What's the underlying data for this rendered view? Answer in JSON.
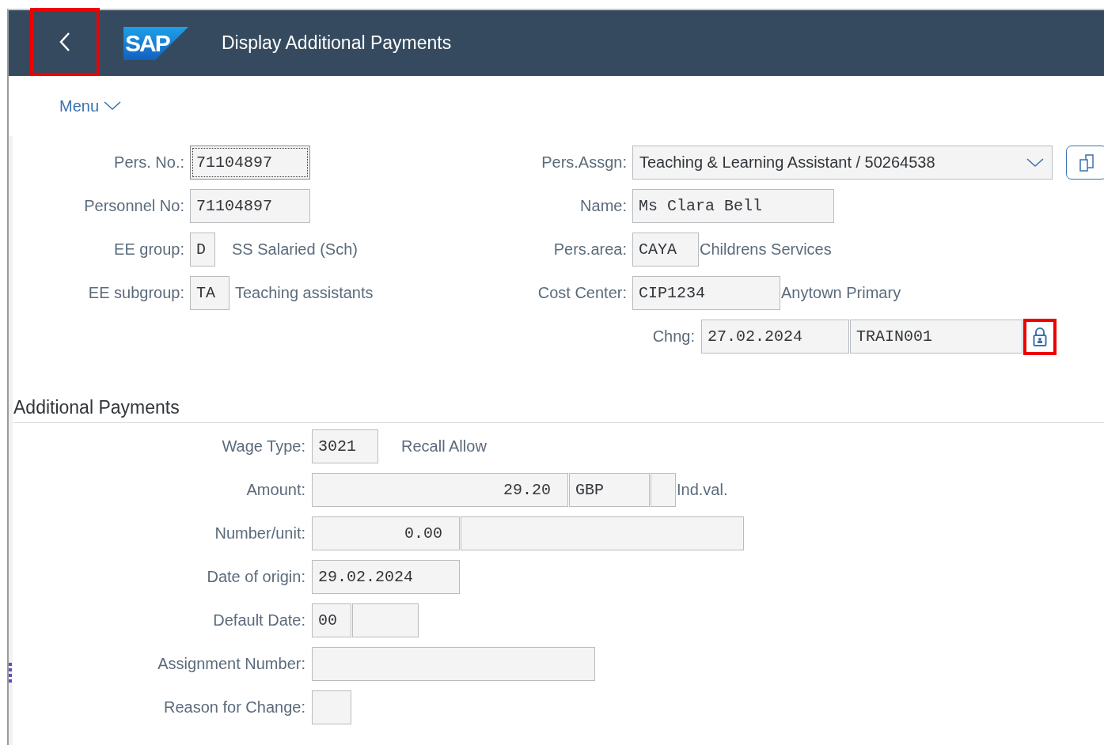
{
  "header": {
    "back_button": {
      "highlighted": true
    },
    "logo": "SAP",
    "title": "Display Additional Payments"
  },
  "menu": "Menu",
  "left_rows": [
    {
      "label": "Pers. No.:",
      "fields": [
        {
          "value": "71104897",
          "focused": true
        }
      ]
    },
    {
      "label": "Personnel No:",
      "fields": [
        {
          "value": "71104897",
          "focused": false
        }
      ]
    },
    {
      "label": "EE group:",
      "fields": [
        {
          "value": "D",
          "focused": false
        }
      ],
      "text": "SS Salaried (Sch)"
    },
    {
      "label": "EE subgroup:",
      "fields": [
        {
          "value": "TA",
          "focused": false
        }
      ],
      "text": "Teaching assistants"
    }
  ],
  "right_rows": [
    {
      "label": "Pers.Assgn:",
      "dropdown": "Teaching & Learning Assistant / 50264538"
    },
    {
      "label": "Name:",
      "fields": [
        {
          "value": "Ms Clara Bell"
        }
      ]
    },
    {
      "label": "Pers.area:",
      "fields": [
        {
          "value": "CAYA"
        }
      ],
      "text": "Childrens Services"
    },
    {
      "label": "Cost Center:",
      "fields": [
        {
          "value": "CIP1234"
        }
      ],
      "text": "Anytown Primary"
    }
  ],
  "change": {
    "label": "Chng:",
    "date": "27.02.2024",
    "user": "TRAIN001",
    "lock_highlighted": true
  },
  "section": {
    "title": "Additional Payments",
    "rows": [
      {
        "label": "Wage Type:",
        "values": [
          "3021"
        ],
        "text": "Recall Allow"
      },
      {
        "label": "Amount:",
        "values": [
          "29.20",
          "GBP"
        ],
        "text": "Ind.val."
      },
      {
        "label": "Number/unit:",
        "values": [
          "0.00"
        ]
      },
      {
        "label": "Date of origin:",
        "values": [
          "29.02.2024"
        ]
      },
      {
        "label": "Default Date:",
        "values": [
          "00"
        ]
      },
      {
        "label": "Assignment Number:"
      },
      {
        "label": "Reason for Change:"
      }
    ]
  }
}
